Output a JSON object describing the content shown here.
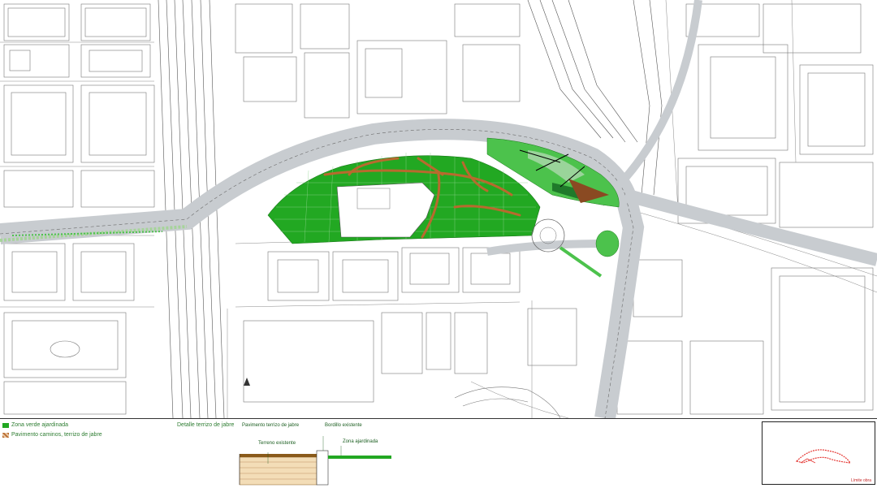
{
  "legend": {
    "zona_verde": "Zona verde ajardinada",
    "pavimento_caminos": "Pavimento caminos, terrizo de jabre"
  },
  "detail": {
    "title": "Detalle terrizo de jabre",
    "pavimento": "Pavimento terrizo de jabre",
    "bordillo": "Bordillo existente",
    "terreno": "Terreno existente",
    "zona_ajardinada": "Zona ajardinada"
  },
  "keymap": {
    "label": "Límite obra"
  },
  "colors": {
    "green": "#22a822",
    "path": "#b86a2e",
    "road": "#c8ccd0",
    "line": "#6a6a6a",
    "keymap_red": "#e53935"
  },
  "icons": {
    "north": "north-arrow-icon"
  }
}
